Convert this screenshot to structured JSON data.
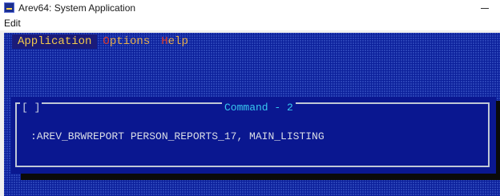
{
  "window": {
    "title": "Arev64: System Application"
  },
  "menubar": {
    "edit_label": "Edit"
  },
  "dos_menu": {
    "items": [
      {
        "label": "Application",
        "active": true
      },
      {
        "label": "Options",
        "active": false
      },
      {
        "label": "Help",
        "active": false
      }
    ]
  },
  "dialog": {
    "close_glyph": "[ ]",
    "title": "Command - 2",
    "command_text": ":AREV_BRWREPORT PERSON_REPORTS_17, MAIN_LISTING"
  },
  "colors": {
    "background_blue": "#0b1f9a",
    "dialog_blue": "#0a1790",
    "menu_yellow": "#e8b04c",
    "hotkey_red": "#d83a2e",
    "title_cyan": "#38c8f0"
  }
}
